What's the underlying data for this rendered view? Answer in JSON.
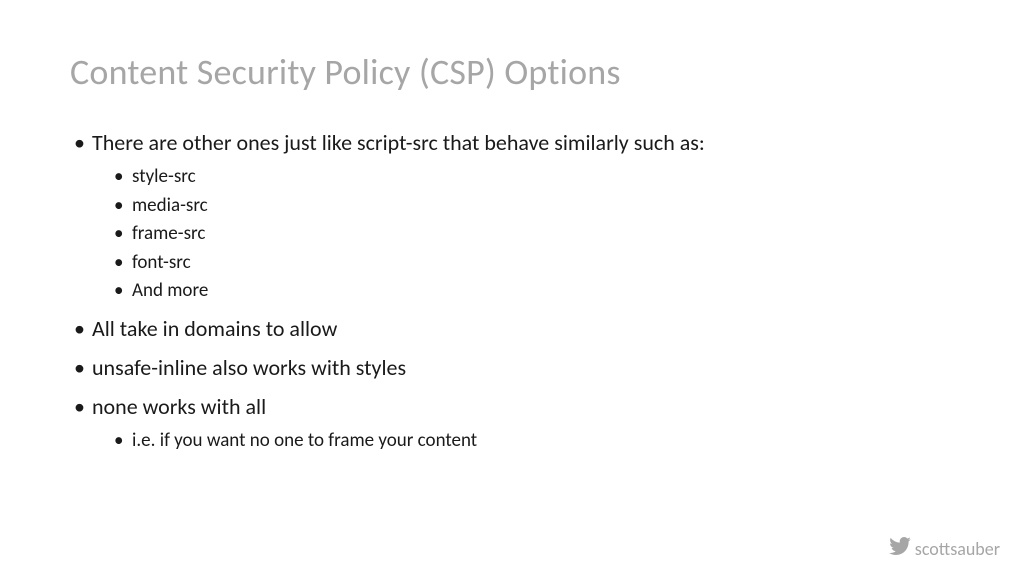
{
  "title": "Content Security Policy (CSP) Options",
  "bullets": {
    "b0": "There are other ones just like script-src that behave similarly such as:",
    "b0_sub": {
      "s0": "style-src",
      "s1": "media-src",
      "s2": "frame-src",
      "s3": "font-src",
      "s4": "And more"
    },
    "b1": "All take in domains to allow",
    "b2": "unsafe-inline also works with styles",
    "b3": "none works with all",
    "b3_sub": {
      "s0": "i.e. if you want no one to frame your content"
    }
  },
  "footer": {
    "handle": "scottsauber"
  }
}
